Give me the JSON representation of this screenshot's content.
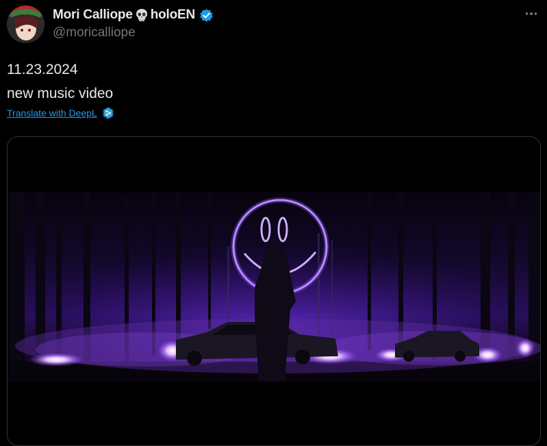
{
  "author": {
    "display_name": "Mori Calliope",
    "name_suffix": "holoEN",
    "handle": "@moricalliope",
    "name_emoji": "skull-icon",
    "verified": true,
    "verified_badge_color": "#1d9bf0"
  },
  "tweet": {
    "lines": [
      "11.23.2024",
      "new music video"
    ],
    "translate_label": "Translate with DeepL"
  },
  "media": {
    "type": "video",
    "accent_color": "#9b4dff"
  },
  "colors": {
    "background": "#000000",
    "text_primary": "#e7e9ea",
    "text_secondary": "#71767b",
    "link": "#1d9bf0"
  }
}
